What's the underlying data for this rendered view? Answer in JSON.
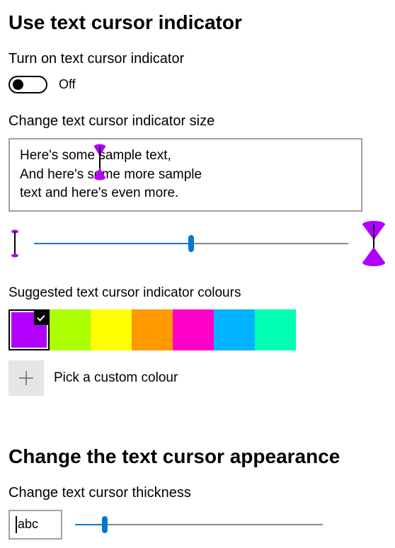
{
  "section1": {
    "title": "Use text cursor indicator",
    "toggle_label": "Turn on text cursor indicator",
    "toggle_state": "Off",
    "size_label": "Change text cursor indicator size",
    "sample": {
      "line1": "Here's some sample text,",
      "line2": "And here's some more sample",
      "line3": "text and here's even more."
    },
    "size_slider": {
      "fill_percent": 50,
      "thumb_percent": 50
    },
    "colours_label": "Suggested text cursor indicator colours",
    "swatches": [
      {
        "color": "#b200ff",
        "selected": true
      },
      {
        "color": "#aaff00",
        "selected": false
      },
      {
        "color": "#ffff00",
        "selected": false
      },
      {
        "color": "#ff9900",
        "selected": false
      },
      {
        "color": "#ff00c8",
        "selected": false
      },
      {
        "color": "#00b2ff",
        "selected": false
      },
      {
        "color": "#00ffb2",
        "selected": false
      }
    ],
    "custom_label": "Pick a custom colour",
    "indicator_color": "#b200ff"
  },
  "section2": {
    "title": "Change the text cursor appearance",
    "thickness_label": "Change text cursor thickness",
    "preview_text": "abc",
    "thickness_slider": {
      "fill_percent": 12,
      "thumb_percent": 12
    }
  }
}
